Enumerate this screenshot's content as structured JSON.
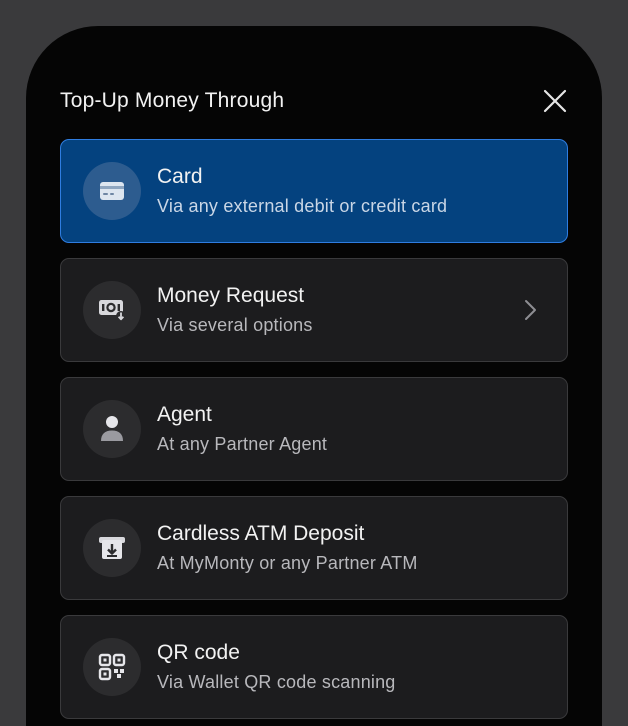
{
  "header": {
    "title": "Top-Up Money Through"
  },
  "options": [
    {
      "title": "Card",
      "subtitle": "Via any external debit or credit card",
      "icon": "credit-card-icon",
      "selected": true
    },
    {
      "title": "Money Request",
      "subtitle": "Via several options",
      "icon": "money-request-icon",
      "selected": false
    },
    {
      "title": "Agent",
      "subtitle": "At any Partner Agent",
      "icon": "person-icon",
      "selected": false
    },
    {
      "title": "Cardless ATM Deposit",
      "subtitle": "At MyMonty or any Partner ATM",
      "icon": "atm-deposit-icon",
      "selected": false
    },
    {
      "title": "QR code",
      "subtitle": "Via Wallet QR code scanning",
      "icon": "qr-code-icon",
      "selected": false
    }
  ],
  "colors": {
    "background": "#050505",
    "frame": "#3a3a3c",
    "card_bg": "#1c1c1e",
    "selected_bg": "#04427f",
    "selected_border": "#2f7de0"
  }
}
